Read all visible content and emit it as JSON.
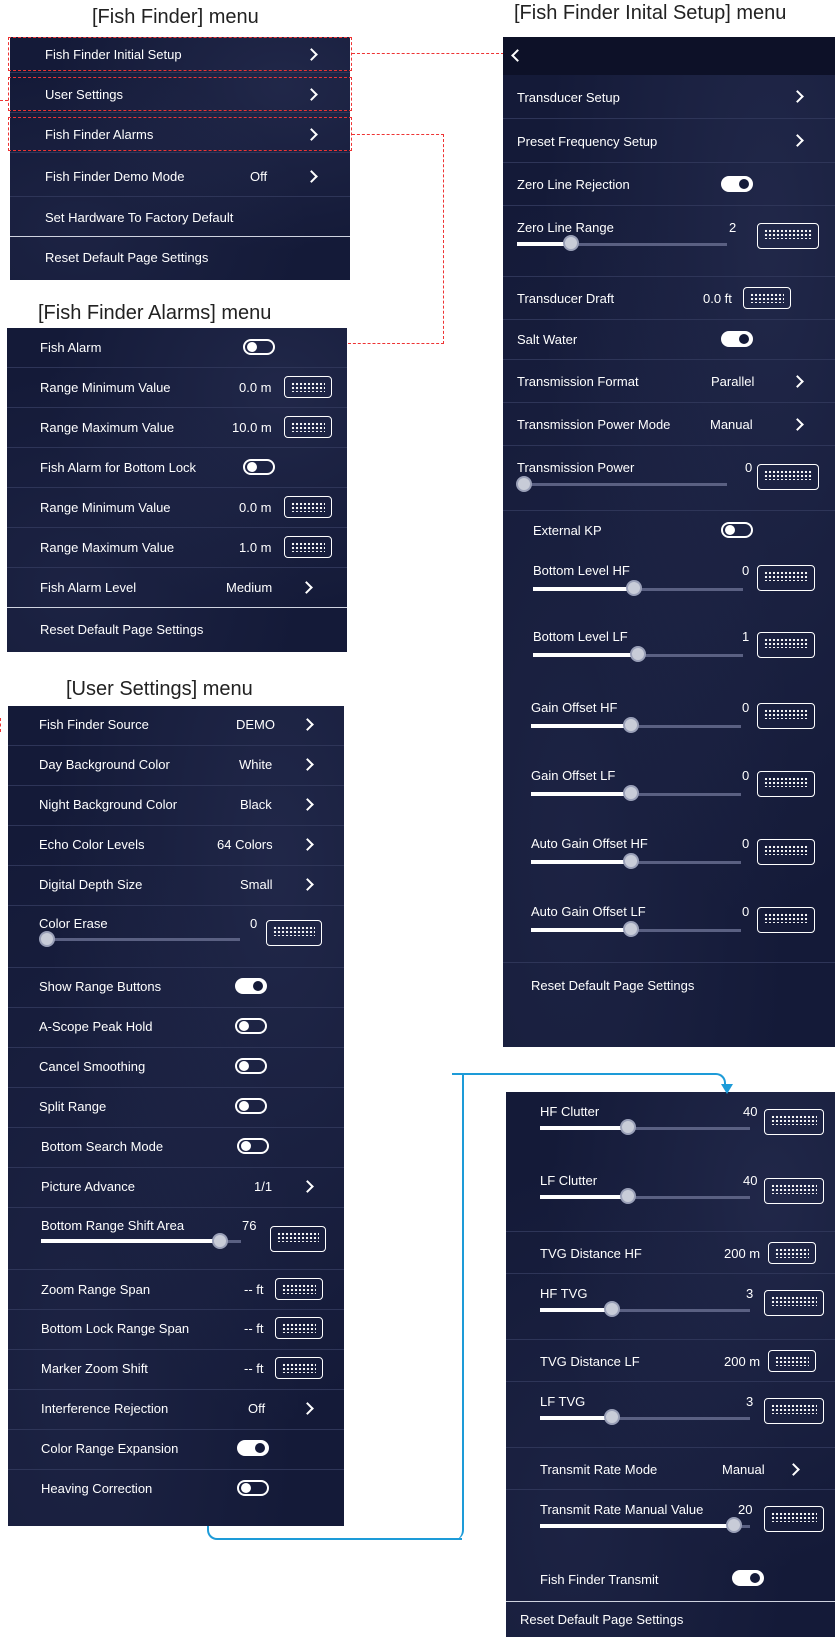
{
  "titles": {
    "fish_finder": "[Fish Finder] menu",
    "initial_setup": "[Fish Finder Inital Setup] menu",
    "alarms": "[Fish Finder Alarms] menu",
    "user_settings": "[User Settings] menu"
  },
  "fish_finder_menu": {
    "initial_setup": "Fish Finder Initial Setup",
    "user_settings": "User Settings",
    "alarms": "Fish Finder Alarms",
    "demo_mode": "Fish Finder Demo Mode",
    "demo_mode_value": "Off",
    "factory_default": "Set Hardware To Factory Default",
    "reset": "Reset Default Page Settings"
  },
  "alarms_menu": {
    "fish_alarm": "Fish Alarm",
    "range_min_1": "Range Minimum Value",
    "range_min_1_value": "0.0 m",
    "range_max_1": "Range Maximum Value",
    "range_max_1_value": "10.0 m",
    "bottom_lock": "Fish Alarm for Bottom Lock",
    "range_min_2": "Range Minimum Value",
    "range_min_2_value": "0.0 m",
    "range_max_2": "Range Maximum Value",
    "range_max_2_value": "1.0 m",
    "alarm_level": "Fish Alarm Level",
    "alarm_level_value": "Medium",
    "reset": "Reset Default Page Settings"
  },
  "user_settings_menu": {
    "source": "Fish Finder Source",
    "source_value": "DEMO",
    "day_bg": "Day Background Color",
    "day_bg_value": "White",
    "night_bg": "Night Background Color",
    "night_bg_value": "Black",
    "echo_levels": "Echo Color Levels",
    "echo_levels_value": "64 Colors",
    "depth_size": "Digital Depth Size",
    "depth_size_value": "Small",
    "color_erase": "Color Erase",
    "color_erase_value": "0",
    "show_range": "Show Range Buttons",
    "ascope": "A-Scope Peak Hold",
    "cancel_smoothing": "Cancel Smoothing",
    "split_range": "Split Range",
    "bottom_search": "Bottom Search Mode",
    "picture_advance": "Picture Advance",
    "picture_advance_value": "1/1",
    "bottom_shift": "Bottom Range Shift Area",
    "bottom_shift_value": "76",
    "zoom_span": "Zoom Range Span",
    "zoom_span_value": "-- ft",
    "bottom_lock_span": "Bottom Lock Range Span",
    "bottom_lock_span_value": "-- ft",
    "marker_zoom": "Marker Zoom Shift",
    "marker_zoom_value": "-- ft",
    "interference": "Interference Rejection",
    "interference_value": "Off",
    "color_range": "Color Range Expansion",
    "heaving": "Heaving Correction"
  },
  "initial_setup_menu": {
    "transducer_setup": "Transducer Setup",
    "preset_freq": "Preset Frequency Setup",
    "zero_line_rej": "Zero Line Rejection",
    "zero_line_range": "Zero Line Range",
    "zero_line_range_value": "2",
    "draft": "Transducer Draft",
    "draft_value": "0.0 ft",
    "salt_water": "Salt Water",
    "tx_format": "Transmission Format",
    "tx_format_value": "Parallel",
    "tx_power_mode": "Transmission Power Mode",
    "tx_power_mode_value": "Manual",
    "tx_power": "Transmission Power",
    "tx_power_value": "0",
    "external_kp": "External KP",
    "bottom_hf": "Bottom Level HF",
    "bottom_hf_value": "0",
    "bottom_lf": "Bottom Level LF",
    "bottom_lf_value": "1",
    "gain_hf": "Gain Offset HF",
    "gain_hf_value": "0",
    "gain_lf": "Gain Offset LF",
    "gain_lf_value": "0",
    "auto_gain_hf": "Auto Gain Offset HF",
    "auto_gain_hf_value": "0",
    "auto_gain_lf": "Auto Gain Offset LF",
    "auto_gain_lf_value": "0",
    "reset": "Reset Default Page Settings"
  },
  "continued_menu": {
    "hf_clutter": "HF Clutter",
    "hf_clutter_value": "40",
    "lf_clutter": "LF Clutter",
    "lf_clutter_value": "40",
    "tvg_dist_hf": "TVG Distance HF",
    "tvg_dist_hf_value": "200 m",
    "hf_tvg": "HF TVG",
    "hf_tvg_value": "3",
    "tvg_dist_lf": "TVG Distance LF",
    "tvg_dist_lf_value": "200 m",
    "lf_tvg": "LF TVG",
    "lf_tvg_value": "3",
    "rate_mode": "Transmit Rate Mode",
    "rate_mode_value": "Manual",
    "rate_manual": "Transmit Rate Manual Value",
    "rate_manual_value": "20",
    "ff_transmit": "Fish Finder Transmit",
    "reset": "Reset Default Page Settings"
  },
  "icons": [
    "chevron-right-icon",
    "back-arrow-icon",
    "keyboard-icon",
    "toggle-switch"
  ]
}
